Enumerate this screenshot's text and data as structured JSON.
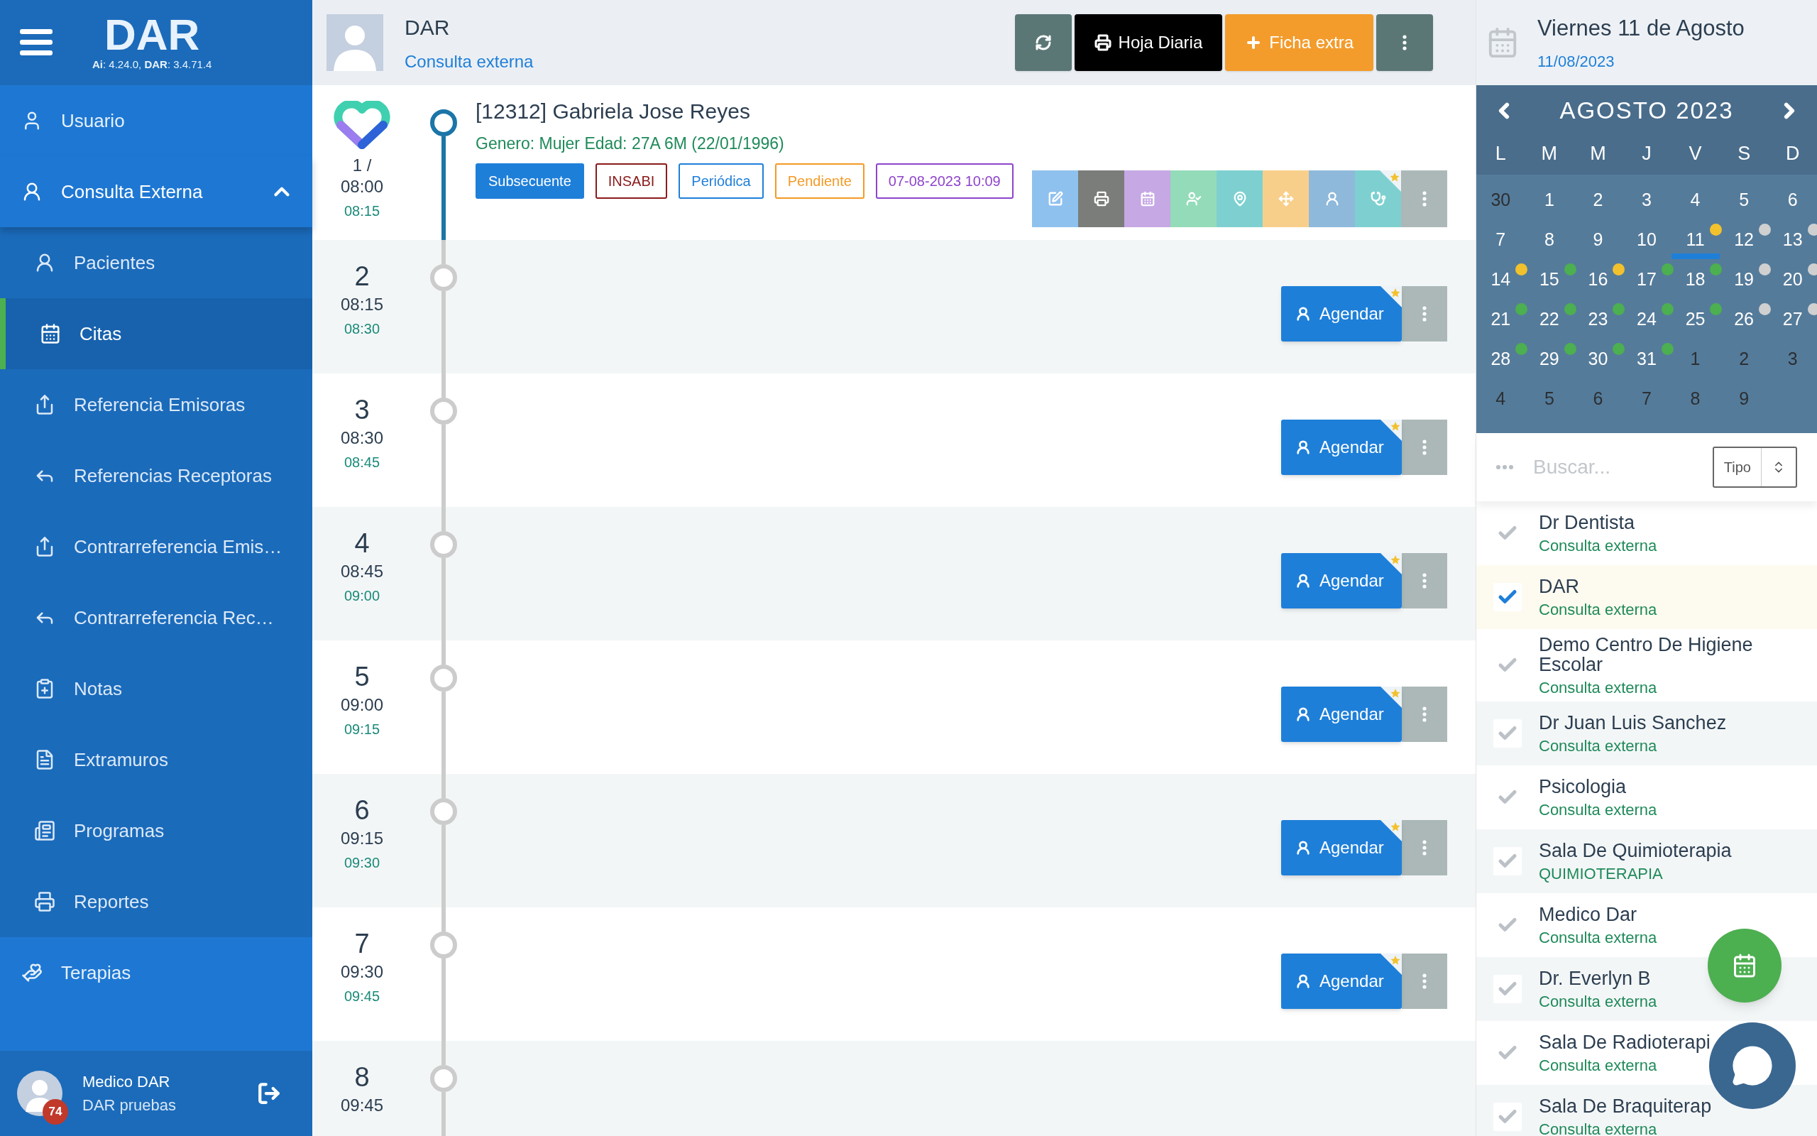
{
  "sidebar": {
    "logo": "DAR",
    "version": "**Ai**: 4.24.0, **DAR**: 3.4.71.4",
    "items": [
      {
        "label": "Usuario",
        "selected": false
      },
      {
        "label": "Consulta Externa",
        "selected": false,
        "expanded": true,
        "children": [
          {
            "label": "Pacientes",
            "selected": false
          },
          {
            "label": "Citas",
            "selected": true
          },
          {
            "label": "Referencia Emisoras",
            "selected": false
          },
          {
            "label": "Referencias Receptoras",
            "selected": false
          },
          {
            "label": "Contrarreferencia Emis…",
            "selected": false
          },
          {
            "label": "Contrarreferencia Rec…",
            "selected": false
          },
          {
            "label": "Notas",
            "selected": false
          },
          {
            "label": "Extramuros",
            "selected": false
          },
          {
            "label": "Programas",
            "selected": false
          },
          {
            "label": "Reportes",
            "selected": false
          }
        ]
      },
      {
        "label": "Terapias",
        "selected": false
      }
    ],
    "user": {
      "name": "Medico DAR",
      "org": "DAR pruebas",
      "badge": "74"
    }
  },
  "header": {
    "title": "DAR",
    "subtitle": "Consulta externa",
    "buttons": [
      {
        "kind": "refresh"
      },
      {
        "kind": "print",
        "label": "Hoja Diaria"
      },
      {
        "kind": "add",
        "label": "Ficha extra"
      },
      {
        "kind": "more"
      }
    ]
  },
  "slots": [
    {
      "kind": "patient",
      "number": "1 /",
      "start": "08:00",
      "end": "08:15",
      "name": "[12312] Gabriela Jose Reyes",
      "info": "Genero: Mujer Edad: 27A 6M (22/01/1996)",
      "tags": [
        {
          "label": "Subsecuente",
          "kind": "filled",
          "color": "#1e7fd9"
        },
        {
          "label": "INSABI",
          "kind": "outline",
          "color": "#8b1a1a"
        },
        {
          "label": "Periódica",
          "kind": "outline",
          "color": "#1e7fd9"
        },
        {
          "label": "Pendiente",
          "kind": "outline",
          "color": "#f39a25"
        },
        {
          "label": "07-08-2023 10:09",
          "kind": "outline",
          "color": "#8e44cc"
        }
      ]
    },
    {
      "kind": "empty",
      "number": "2",
      "start": "08:15",
      "end": "08:30",
      "action": "Agendar"
    },
    {
      "kind": "empty",
      "number": "3",
      "start": "08:30",
      "end": "08:45",
      "action": "Agendar"
    },
    {
      "kind": "empty",
      "number": "4",
      "start": "08:45",
      "end": "09:00",
      "action": "Agendar"
    },
    {
      "kind": "empty",
      "number": "5",
      "start": "09:00",
      "end": "09:15",
      "action": "Agendar"
    },
    {
      "kind": "empty",
      "number": "6",
      "start": "09:15",
      "end": "09:30",
      "action": "Agendar"
    },
    {
      "kind": "empty",
      "number": "7",
      "start": "09:30",
      "end": "09:45",
      "action": "Agendar"
    },
    {
      "kind": "empty",
      "number": "8",
      "start": "09:45"
    }
  ],
  "date_panel": {
    "title": "Viernes 11 de Agosto",
    "date": "11/08/2023"
  },
  "calendar": {
    "month": "AGOSTO 2023",
    "weekdays": [
      "L",
      "M",
      "M",
      "J",
      "V",
      "S",
      "D"
    ],
    "weeks": [
      [
        {
          "day": "30",
          "muted": true
        },
        {
          "day": "1",
          "muted": false
        },
        {
          "day": "2",
          "muted": false
        },
        {
          "day": "3",
          "muted": false
        },
        {
          "day": "4",
          "muted": false
        },
        {
          "day": "5",
          "muted": false
        },
        {
          "day": "6",
          "muted": false
        }
      ],
      [
        {
          "day": "7",
          "muted": false
        },
        {
          "day": "8",
          "muted": false
        },
        {
          "day": "9",
          "muted": false
        },
        {
          "day": "10",
          "muted": false
        },
        {
          "day": "11",
          "muted": false,
          "selected": true,
          "color": "#f2c12e"
        },
        {
          "day": "12",
          "muted": false,
          "color": "#d0d0d0"
        },
        {
          "day": "13",
          "muted": false,
          "color": "#d0d0d0"
        }
      ],
      [
        {
          "day": "14",
          "muted": false,
          "color": "#f2c12e"
        },
        {
          "day": "15",
          "muted": false,
          "color": "#4caf50"
        },
        {
          "day": "16",
          "muted": false,
          "color": "#f2c12e"
        },
        {
          "day": "17",
          "muted": false,
          "color": "#4caf50"
        },
        {
          "day": "18",
          "muted": false,
          "color": "#4caf50"
        },
        {
          "day": "19",
          "muted": false,
          "color": "#d0d0d0"
        },
        {
          "day": "20",
          "muted": false,
          "color": "#d0d0d0"
        }
      ],
      [
        {
          "day": "21",
          "muted": false,
          "color": "#4caf50"
        },
        {
          "day": "22",
          "muted": false,
          "color": "#4caf50"
        },
        {
          "day": "23",
          "muted": false,
          "color": "#4caf50"
        },
        {
          "day": "24",
          "muted": false,
          "color": "#4caf50"
        },
        {
          "day": "25",
          "muted": false,
          "color": "#4caf50"
        },
        {
          "day": "26",
          "muted": false,
          "color": "#d0d0d0"
        },
        {
          "day": "27",
          "muted": false,
          "color": "#d0d0d0"
        }
      ],
      [
        {
          "day": "28",
          "muted": false,
          "color": "#4caf50"
        },
        {
          "day": "29",
          "muted": false,
          "color": "#4caf50"
        },
        {
          "day": "30",
          "muted": false,
          "color": "#4caf50"
        },
        {
          "day": "31",
          "muted": false,
          "color": "#4caf50"
        },
        {
          "day": "1",
          "muted": true
        },
        {
          "day": "2",
          "muted": true
        },
        {
          "day": "3",
          "muted": true
        }
      ],
      [
        {
          "day": "4",
          "muted": true
        },
        {
          "day": "5",
          "muted": true
        },
        {
          "day": "6",
          "muted": true
        },
        {
          "day": "7",
          "muted": true
        },
        {
          "day": "8",
          "muted": true
        },
        {
          "day": "9",
          "muted": true
        }
      ]
    ]
  },
  "search": {
    "placeholder": "Buscar...",
    "type_select": "Tipo"
  },
  "agendas": [
    {
      "name": "Dr Dentista",
      "service": "Consulta externa",
      "selected": false
    },
    {
      "name": "DAR",
      "service": "Consulta externa",
      "selected": true
    },
    {
      "name": "Demo Centro De Higiene Escolar",
      "service": "Consulta externa",
      "selected": false
    },
    {
      "name": "Dr Juan Luis Sanchez",
      "service": "Consulta externa",
      "selected": false
    },
    {
      "name": "Psicologia",
      "service": "Consulta externa",
      "selected": false
    },
    {
      "name": "Sala De Quimioterapia",
      "service": "QUIMIOTERAPIA",
      "selected": false
    },
    {
      "name": "Medico Dar",
      "service": "Consulta externa",
      "selected": false
    },
    {
      "name": "Dr. Everlyn B",
      "service": "Consulta externa",
      "selected": false
    },
    {
      "name": "Sala De Radioterapi",
      "service": "Consulta externa",
      "selected": false
    },
    {
      "name": "Sala De Braquiterap",
      "service": "Consulta externa",
      "selected": false
    }
  ]
}
